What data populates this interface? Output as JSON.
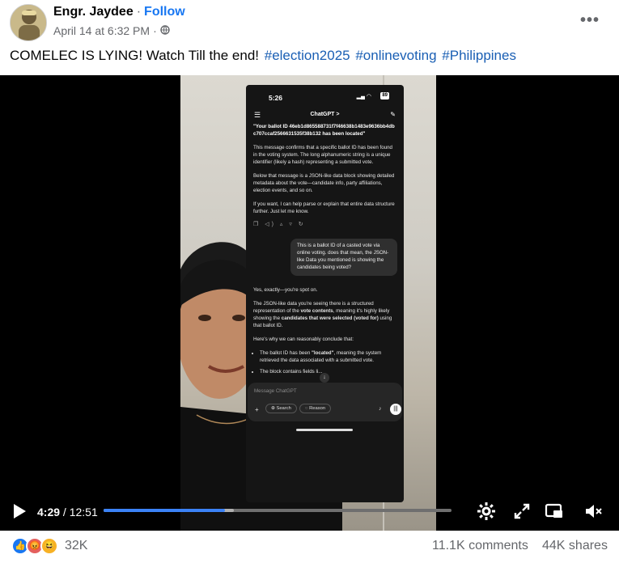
{
  "post": {
    "author": "Engr. Jaydee",
    "follow_label": "Follow",
    "timestamp": "April 14 at 6:32 PM",
    "separator": "·",
    "audience_icon": "globe-icon",
    "more_label": "•••",
    "caption_text": "COMELEC IS LYING! Watch Till the end!",
    "hashtags": [
      "#election2025",
      "#onlinevoting",
      "#Philippines"
    ]
  },
  "phone": {
    "status_time": "5:26",
    "battery": "89",
    "chat_title": "ChatGPT >",
    "ballot_line": "\"Your ballot ID 46eb1d865588731f7f46638b1483e9636bb4dbc707ccaf2566631535f38b132 has been located\"",
    "para1": "This message confirms that a specific ballot ID has been found in the voting system. The long alphanumeric string is a unique identifier (likely a hash) representing a submitted vote.",
    "para2": "Below that message is a JSON-like data block showing detailed metadata about the vote—candidate info, party affiliations, election events, and so on.",
    "para3": "If you want, I can help parse or explain that entire data structure further. Just let me know.",
    "user_message": "This is a ballot ID of a casted vote via online voting. does that mean, the JSON-like Data you mentioned is showing the candidates being voted?",
    "reply_intro": "Yes, exactly—you're spot on.",
    "reply_p1_a": "The JSON-like data you're seeing there is a structured representation of the ",
    "reply_p1_b": "vote contents",
    "reply_p1_c": ", meaning it's highly likely showing the ",
    "reply_p1_d": "candidates that were selected (voted for)",
    "reply_p1_e": " using that ballot ID.",
    "reply_p2": "Here's why we can reasonably conclude that:",
    "bullet1_a": "The ballot ID has been ",
    "bullet1_b": "\"located\"",
    "bullet1_c": ", meaning the system retrieved the data associated with a submitted vote.",
    "bullet2": "The block contains fields li...",
    "composer_placeholder": "Message ChatGPT",
    "search_label": "Search",
    "reason_label": "Reason"
  },
  "player": {
    "current_time": "4:29",
    "time_separator": " / ",
    "duration": "12:51",
    "progress": 0.349,
    "buffered": 0.375
  },
  "footer": {
    "reaction_count": "32K",
    "comments": "11.1K comments",
    "shares": "44K shares"
  },
  "colors": {
    "link": "#1877f2",
    "hashtag": "#1a5fb4",
    "progress": "#3b82f6"
  }
}
